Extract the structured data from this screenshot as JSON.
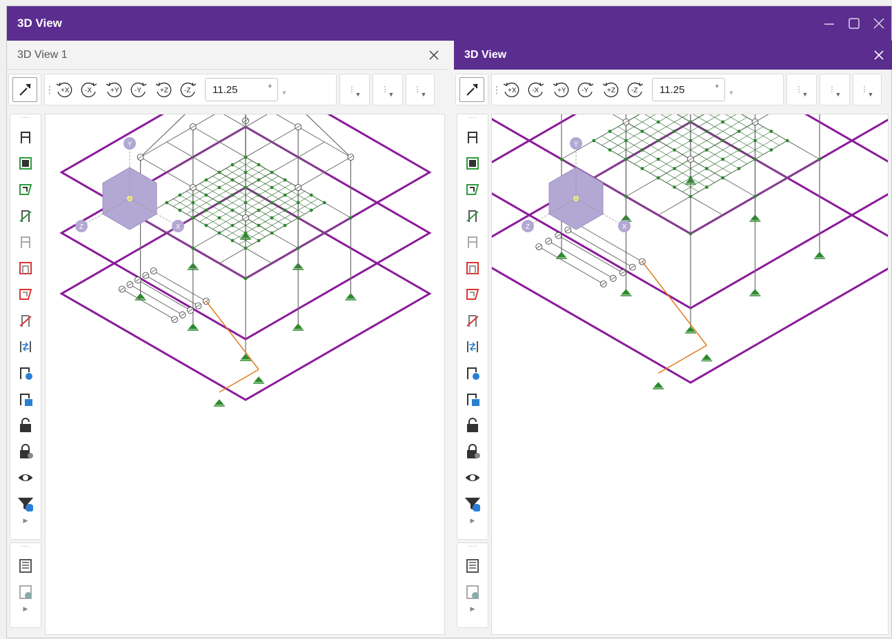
{
  "window": {
    "title": "3D View"
  },
  "left_pane": {
    "tab_title": "3D View 1",
    "angle_value": "11.25",
    "angle_unit": "°",
    "rotate_buttons": [
      "+X",
      "-X",
      "+Y",
      "-Y",
      "+Z",
      "-Z"
    ],
    "axes": {
      "y": "Y",
      "z": "Z",
      "x": "X"
    }
  },
  "right_pane": {
    "tab_title": "3D View",
    "angle_value": "11.25",
    "angle_unit": "°",
    "rotate_buttons": [
      "+X",
      "-X",
      "+Y",
      "-Y",
      "+Z",
      "-Z"
    ],
    "axes": {
      "y": "Y",
      "z": "Z",
      "x": "X"
    }
  },
  "colors": {
    "title_bar": "#5a2d8f",
    "slab_outline": "#8b1a9a",
    "frame": "#6a6a6a",
    "mesh": "#3a6f3a",
    "support": "#2d8a2d",
    "orange_member": "#e07b1a",
    "selected_member": "#1f3fe0",
    "cube": "#b3a7d3"
  },
  "vertical_toolbar_icons": [
    "frame-icon",
    "frame-green-box-icon",
    "frame-green-shell-icon",
    "frame-green-diagonal-icon",
    "frame-faded-icon",
    "frame-red-box-icon",
    "frame-red-shell-icon",
    "frame-red-diagonal-icon",
    "align-arrows-icon",
    "frame-settings-icon",
    "frame-save-icon",
    "unlock-icon",
    "lock-eye-icon",
    "eye-icon",
    "filter-download-icon"
  ],
  "secondary_toolbar_icons": [
    "report-icon",
    "report-image-icon"
  ]
}
